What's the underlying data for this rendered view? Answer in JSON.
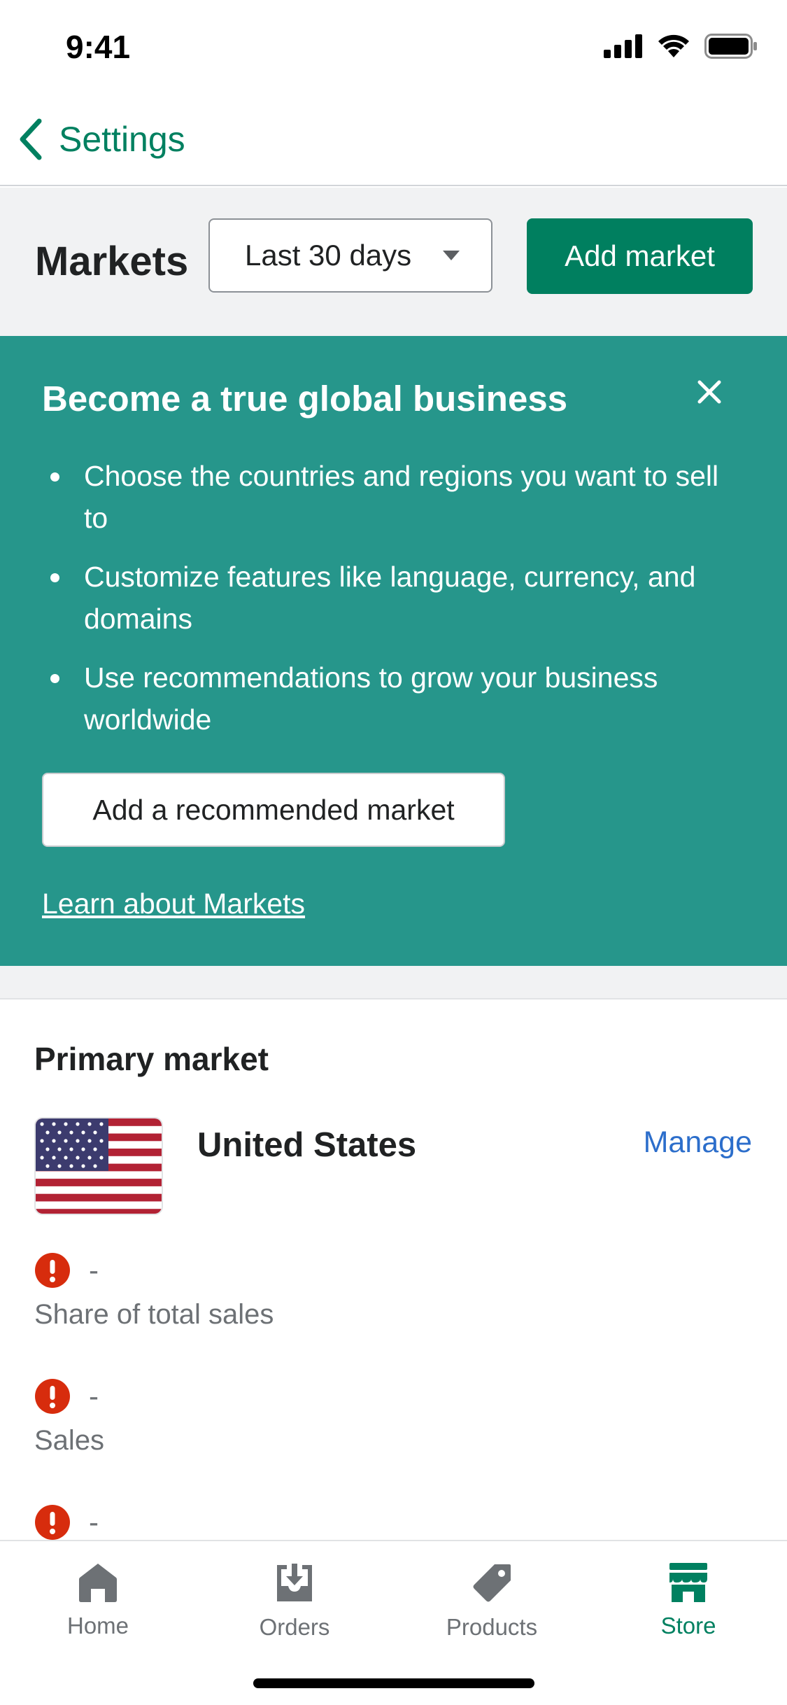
{
  "status_bar": {
    "time": "9:41",
    "icons": [
      "cellular-signal-icon",
      "wifi-icon",
      "battery-icon"
    ]
  },
  "nav": {
    "back_label": "Settings",
    "back_icon": "chevron-left-icon"
  },
  "header": {
    "title": "Markets",
    "date_range": "Last 30 days",
    "add_market_label": "Add market"
  },
  "banner": {
    "title": "Become a true global business",
    "bullets": [
      "Choose the countries and regions you want to sell to",
      "Customize features like language, currency, and domains",
      "Use recommendations to grow your business worldwide"
    ],
    "primary_action": "Add a recommended market",
    "link": "Learn about Markets"
  },
  "primary_market": {
    "section_title": "Primary market",
    "name": "United States",
    "flag": "us-flag-icon",
    "manage_label": "Manage",
    "metrics": [
      {
        "value": "-",
        "label": "Share of total sales",
        "status_icon": "alert-icon"
      },
      {
        "value": "-",
        "label": "Sales",
        "status_icon": "alert-icon"
      },
      {
        "value": "-",
        "label": "",
        "status_icon": "alert-icon"
      }
    ]
  },
  "tabs": [
    {
      "label": "Home",
      "icon": "home-icon"
    },
    {
      "label": "Orders",
      "icon": "orders-icon"
    },
    {
      "label": "Products",
      "icon": "tag-icon"
    },
    {
      "label": "Store",
      "icon": "store-icon",
      "active": true
    }
  ],
  "colors": {
    "brand_green": "#008060",
    "button_green": "#007f5f",
    "banner_teal": "#26968b",
    "link_blue": "#2c6ecb",
    "critical_red": "#d72c0d"
  }
}
